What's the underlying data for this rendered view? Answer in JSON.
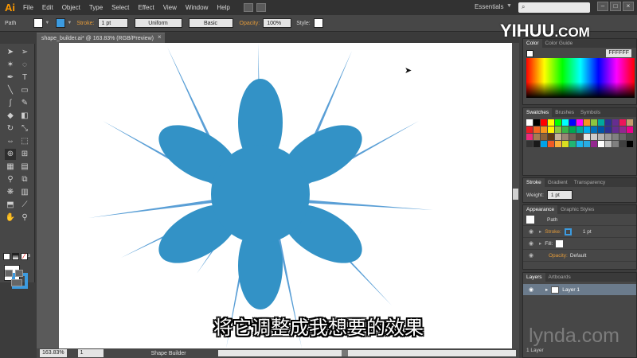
{
  "menubar": {
    "app_logo": "Ai",
    "items": [
      "File",
      "Edit",
      "Object",
      "Type",
      "Select",
      "Effect",
      "View",
      "Window",
      "Help"
    ],
    "workspace": "Essentials"
  },
  "controlbar": {
    "selection": "Path",
    "stroke_label": "Stroke:",
    "stroke_weight": "1 pt",
    "stroke_profile": "Uniform",
    "brush": "Basic",
    "opacity_label": "Opacity:",
    "opacity": "100%",
    "style_label": "Style:"
  },
  "document": {
    "tab_title": "shape_builder.ai* @ 163.83% (RGB/Preview)",
    "fill_color": "#3392c6"
  },
  "statusbar": {
    "zoom": "163.83%",
    "page": "1",
    "tool": "Shape Builder"
  },
  "panels": {
    "color": {
      "tabs": [
        "Color",
        "Color Guide"
      ],
      "hex": "FFFFFF"
    },
    "swatches": {
      "tabs": [
        "Swatches",
        "Brushes",
        "Symbols"
      ]
    },
    "stroke": {
      "tabs": [
        "Stroke",
        "Gradient",
        "Transparency"
      ],
      "weight_label": "Weight:",
      "weight": "1 pt"
    },
    "appearance": {
      "tabs": [
        "Appearance",
        "Graphic Styles"
      ],
      "object": "Path",
      "stroke_label": "Stroke:",
      "stroke_value": "1 pt",
      "fill_label": "Fill:",
      "opacity_label": "Opacity:",
      "opacity_value": "Default"
    },
    "layers": {
      "tabs": [
        "Layers",
        "Artboards"
      ],
      "layer_name": "Layer 1",
      "count": "1 Layer"
    }
  },
  "watermarks": {
    "top": "YIHUU",
    "top_suffix": ".COM",
    "bottom": "lynda.com"
  },
  "subtitle": "将它调整成我想要的效果"
}
